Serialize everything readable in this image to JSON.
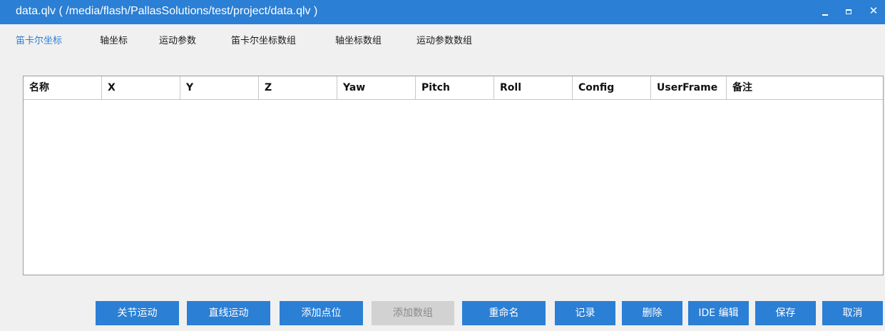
{
  "window": {
    "title": "data.qlv ( /media/flash/PallasSolutions/test/project/data.qlv )",
    "minimize_label": "",
    "maximize_label": "",
    "close_label": "✕"
  },
  "tabs": [
    {
      "label": "笛卡尔坐标",
      "active": true
    },
    {
      "label": "轴坐标",
      "active": false
    },
    {
      "label": "运动参数",
      "active": false
    },
    {
      "label": "笛卡尔坐标数组",
      "active": false
    },
    {
      "label": "轴坐标数组",
      "active": false
    },
    {
      "label": "运动参数数组",
      "active": false
    }
  ],
  "table": {
    "columns": [
      "名称",
      "X",
      "Y",
      "Z",
      "Yaw",
      "Pitch",
      "Roll",
      "Config",
      "UserFrame",
      "备注"
    ],
    "rows": []
  },
  "buttons": [
    {
      "label": "关节运动",
      "enabled": true
    },
    {
      "label": "直线运动",
      "enabled": true
    },
    {
      "label": "添加点位",
      "enabled": true
    },
    {
      "label": "添加数组",
      "enabled": false
    },
    {
      "label": "重命名",
      "enabled": true
    },
    {
      "label": "记录",
      "enabled": true
    },
    {
      "label": "删除",
      "enabled": true
    },
    {
      "label": "IDE 编辑",
      "enabled": true
    },
    {
      "label": "保存",
      "enabled": true
    },
    {
      "label": "取消",
      "enabled": true
    }
  ],
  "colors": {
    "accent": "#2b7fd4",
    "disabled_button": "#d2d2d2",
    "background": "#f0f0f0"
  }
}
